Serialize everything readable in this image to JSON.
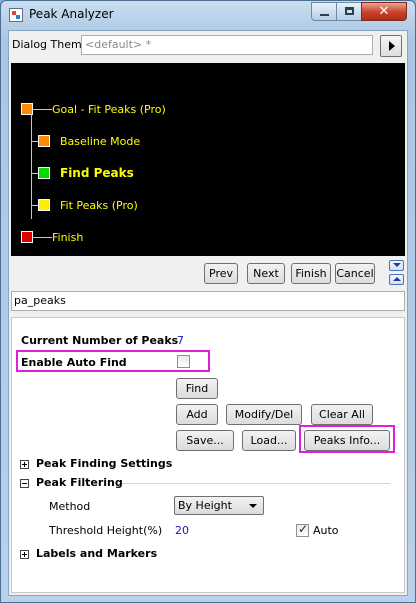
{
  "window": {
    "title": "Peak Analyzer",
    "close_glyph": "✕"
  },
  "theme": {
    "label": "Dialog Theme",
    "value": "<default> *"
  },
  "flow": {
    "steps": [
      {
        "label": "Goal - Fit Peaks (Pro)",
        "color": "#ff8c00"
      },
      {
        "label": "Baseline Mode",
        "color": "#ff8c00"
      },
      {
        "label": "Find Peaks",
        "color": "#00dd00"
      },
      {
        "label": "Fit Peaks (Pro)",
        "color": "#ffee00"
      },
      {
        "label": "Finish",
        "color": "#e00000"
      }
    ]
  },
  "nav": {
    "prev": "Prev",
    "next": "Next",
    "finish": "Finish",
    "cancel": "Cancel"
  },
  "name_field": {
    "value": "pa_peaks"
  },
  "find_peaks": {
    "current_label": "Current Number of Peaks",
    "current_value": "7",
    "auto_find_label": "Enable Auto Find",
    "auto_find_checked": false,
    "buttons": {
      "find": "Find",
      "add": "Add",
      "modify": "Modify/Del",
      "clear": "Clear All",
      "save": "Save...",
      "load": "Load...",
      "peaks_info": "Peaks Info..."
    },
    "highlight_color": "#e020d8"
  },
  "sections": {
    "finding_settings": "Peak Finding Settings",
    "filtering": "Peak Filtering",
    "labels_markers": "Labels and Markers"
  },
  "filtering": {
    "method_label": "Method",
    "method_value": "By Height",
    "threshold_label": "Threshold Height(%)",
    "threshold_value": "20",
    "auto_label": "Auto",
    "auto_checked": true
  }
}
